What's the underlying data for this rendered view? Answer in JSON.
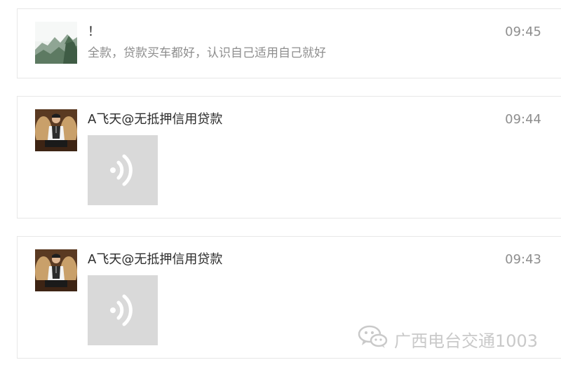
{
  "messages": [
    {
      "sender": "！",
      "time": "09:45",
      "preview": "全款，贷款买车都好，认识自己适用自己就好",
      "avatar_icon": "landscape-avatar-icon"
    },
    {
      "sender": "A飞天@无抵押信用贷款",
      "time": "09:44",
      "attachment_icon": "voice-message-icon",
      "avatar_icon": "person-avatar-icon"
    },
    {
      "sender": "A飞天@无抵押信用贷款",
      "time": "09:43",
      "attachment_icon": "voice-message-icon",
      "avatar_icon": "person-avatar-icon"
    }
  ],
  "watermark": {
    "text": "广西电台交通1003",
    "icon": "wechat-logo-icon"
  },
  "colors": {
    "card_border": "#e7e7e7",
    "text_primary": "#2b2b2b",
    "text_secondary": "#8e8e8e",
    "voice_tile": "#d9d9d9",
    "watermark": "#c9c9c9"
  }
}
